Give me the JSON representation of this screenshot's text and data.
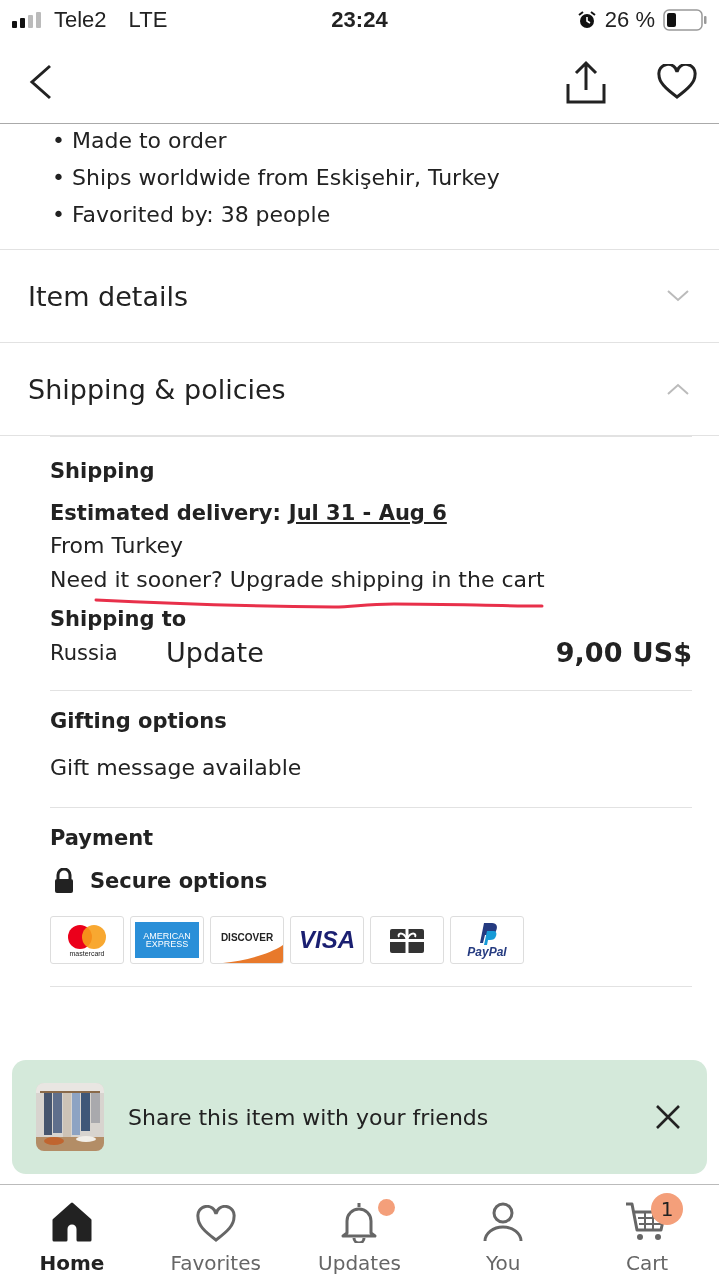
{
  "status_bar": {
    "carrier": "Tele2",
    "network": "LTE",
    "time": "23:24",
    "battery": "26 %"
  },
  "highlights": [
    "• Made to order",
    "• Ships worldwide from Eskişehir, Turkey",
    "• Favorited by: 38 people"
  ],
  "sections": [
    {
      "title": "Item details",
      "expanded": false
    },
    {
      "title": "Shipping & policies",
      "expanded": true
    }
  ],
  "shipping": {
    "heading": "Shipping",
    "delivery_label": "Estimated delivery:",
    "delivery_dates": "Jul 31 - Aug 6",
    "origin": "From Turkey",
    "upgrade_note": "Need it sooner? Upgrade shipping in the cart",
    "to_heading": "Shipping to",
    "country": "Russia",
    "update_link": "Update",
    "price": "9,00 US$"
  },
  "gifting": {
    "heading": "Gifting options",
    "note": "Gift message available"
  },
  "payment": {
    "heading": "Payment",
    "secure": "Secure options",
    "methods": [
      {
        "kind": "mastercard",
        "label": "mastercard"
      },
      {
        "kind": "amex",
        "label": "AMERICAN EXPRESS"
      },
      {
        "kind": "discover",
        "label": "DISCOVER"
      },
      {
        "kind": "visa",
        "label": "VISA"
      },
      {
        "kind": "giftcard"
      },
      {
        "kind": "paypal",
        "label": "PayPal"
      }
    ]
  },
  "share_banner": {
    "text": "Share this item with your friends"
  },
  "tab_bar": [
    {
      "kind": "home",
      "label": "Home",
      "selected": true
    },
    {
      "kind": "favorites",
      "label": "Favorites",
      "selected": false
    },
    {
      "kind": "updates",
      "label": "Updates",
      "selected": false,
      "dot": true
    },
    {
      "kind": "you",
      "label": "You",
      "selected": false
    },
    {
      "kind": "cart",
      "label": "Cart",
      "selected": false,
      "badge": "1"
    }
  ]
}
